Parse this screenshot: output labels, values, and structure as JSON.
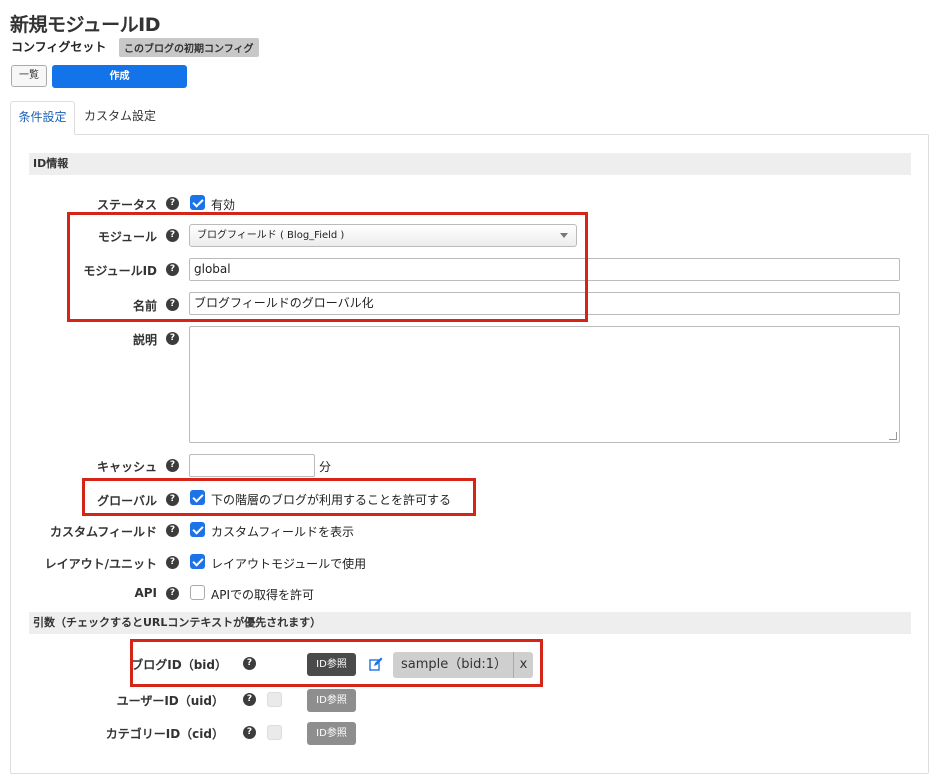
{
  "header": {
    "title": "新規モジュールID",
    "config_set_label": "コンフィグセット",
    "config_set_badge": "このブログの初期コンフィグ"
  },
  "toolbar": {
    "list_label": "一覧",
    "create_label": "作成"
  },
  "tabs": [
    {
      "label": "条件設定",
      "active": true
    },
    {
      "label": "カスタム設定",
      "active": false
    }
  ],
  "section_id": {
    "heading": "ID情報",
    "status": {
      "label": "ステータス",
      "checkbox_label": "有効",
      "checked": true
    },
    "module": {
      "label": "モジュール",
      "selected": "ブログフィールド ( Blog_Field )"
    },
    "module_id": {
      "label": "モジュールID",
      "value": "global"
    },
    "name": {
      "label": "名前",
      "value": "ブログフィールドのグローバル化"
    },
    "description": {
      "label": "説明",
      "value": ""
    },
    "cache": {
      "label": "キャッシュ",
      "value": "",
      "unit": "分"
    },
    "global": {
      "label": "グローバル",
      "checkbox_label": "下の階層のブログが利用することを許可する",
      "checked": true
    },
    "custom_field": {
      "label": "カスタムフィールド",
      "checkbox_label": "カスタムフィールドを表示",
      "checked": true
    },
    "layout": {
      "label": "レイアウト/ユニット",
      "checkbox_label": "レイアウトモジュールで使用",
      "checked": true
    },
    "api": {
      "label": "API",
      "checkbox_label": "APIでの取得を許可",
      "checked": false
    }
  },
  "section_args": {
    "heading": "引数（チェックするとURLコンテキストが優先されます）",
    "blog_id": {
      "label": "ブログID（bid）",
      "button": "ID参照",
      "value": "sample（bid:1）",
      "clear": "x"
    },
    "user_id": {
      "label": "ユーザーID（uid）",
      "button": "ID参照"
    },
    "category_id": {
      "label": "カテゴリーID（cid）",
      "button": "ID参照"
    }
  },
  "help_glyph": "?",
  "colors": {
    "primary": "#1274e8",
    "highlight": "#d52518",
    "checkbox": "#1a73e8"
  }
}
